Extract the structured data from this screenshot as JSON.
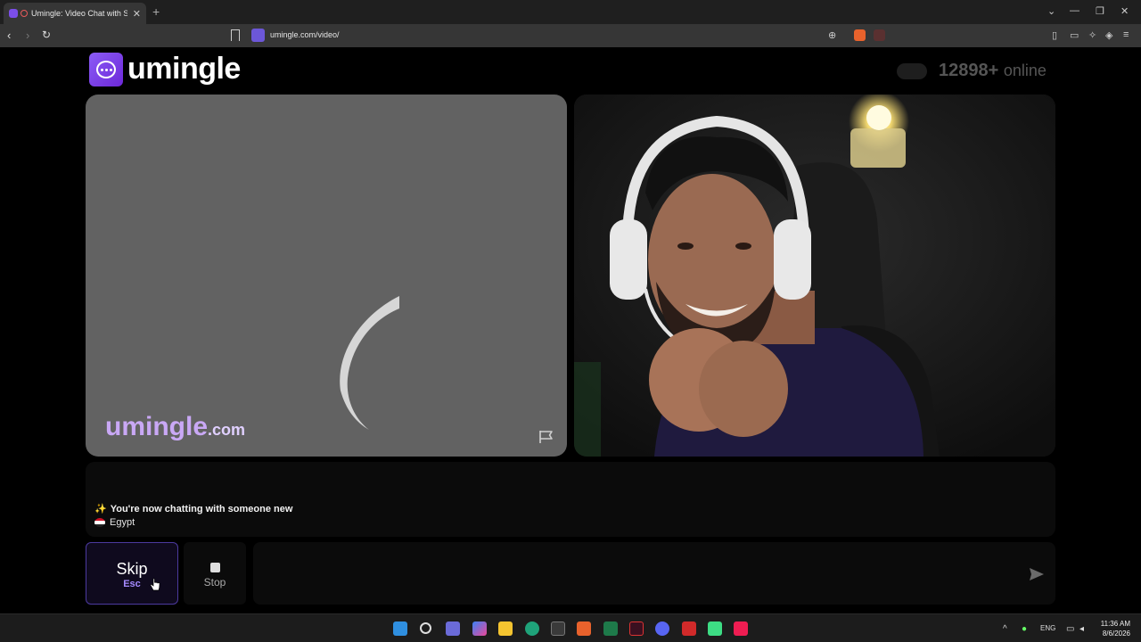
{
  "browser": {
    "tab_title": "Umingle: Video Chat with Str",
    "tab_close": "✕",
    "new_tab": "+",
    "url": "umingle.com/video/",
    "window_controls": [
      "⌄",
      "—",
      "❐",
      "✕"
    ]
  },
  "header": {
    "logo_text": "umingle",
    "online_count": "12898+",
    "online_label": "online"
  },
  "left_video": {
    "watermark_main": "umingle",
    "watermark_suffix": ".com",
    "state": "loading"
  },
  "chat": {
    "spark_icon": "✨",
    "status_message": "You're now chatting with someone new",
    "country": "Egypt"
  },
  "controls": {
    "skip_label": "Skip",
    "skip_key": "Esc",
    "stop_label": "Stop",
    "message_placeholder": ""
  },
  "taskbar": {
    "lang": "ENG",
    "time": "11:36 AM",
    "date": "8/6/2026",
    "tray_up": "^"
  },
  "colors": {
    "brand_purple": "#7c3aed",
    "watermark_purple": "#c9a8f5",
    "skip_border": "#4c3aa0"
  }
}
